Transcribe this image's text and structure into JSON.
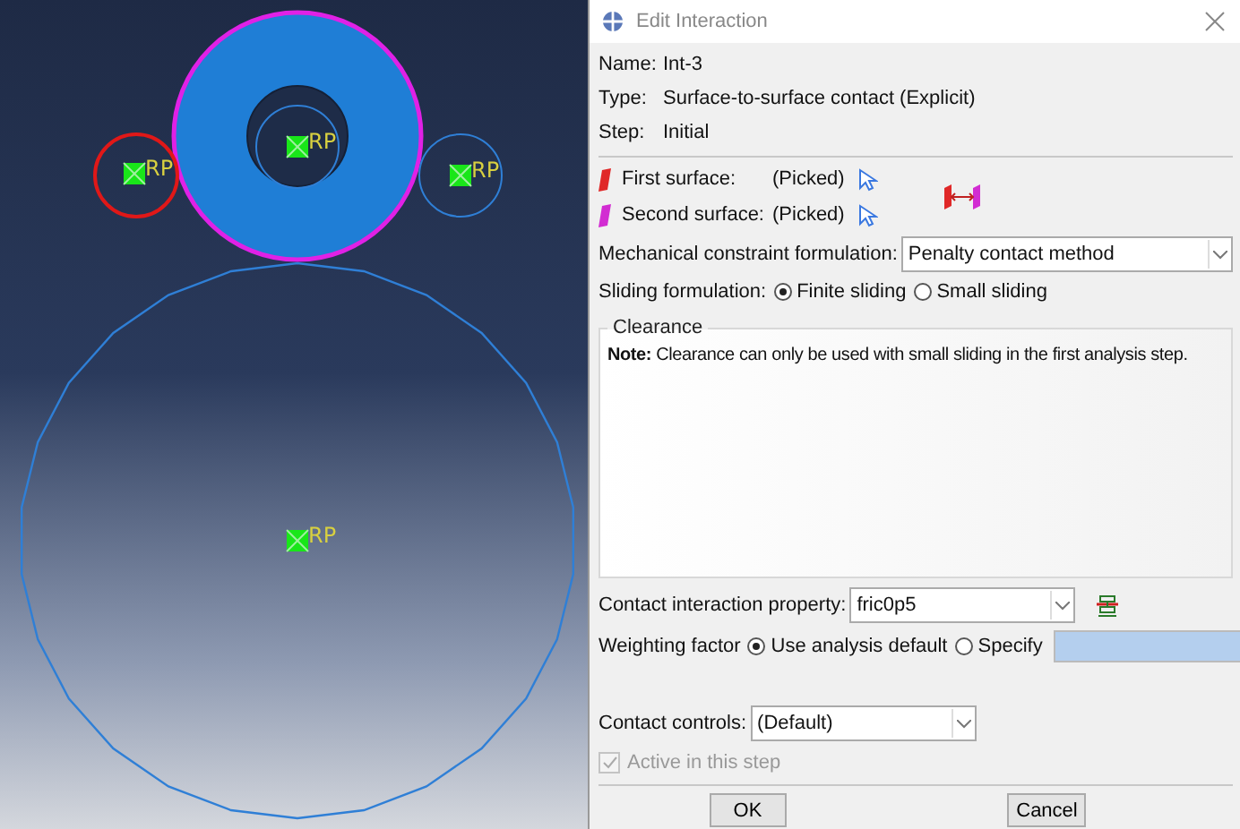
{
  "viewport": {
    "markers": [
      {
        "label": "RP"
      },
      {
        "label": "RP"
      },
      {
        "label": "RP"
      },
      {
        "label": "RP"
      }
    ]
  },
  "dialog": {
    "title": "Edit Interaction",
    "fields": [
      {
        "label": "Name:",
        "value": "Int-3"
      },
      {
        "label": "Type:",
        "value": "Surface-to-surface contact (Explicit)"
      },
      {
        "label": "Step:",
        "value": "Initial"
      }
    ],
    "surfaces": [
      {
        "label": "First surface:",
        "value": "(Picked)",
        "color": "#e02828"
      },
      {
        "label": "Second surface:",
        "value": "(Picked)",
        "color": "#d22cd2"
      }
    ],
    "mechanical": {
      "label": "Mechanical constraint formulation:",
      "value": "Penalty contact method"
    },
    "sliding": {
      "label": "Sliding formulation:",
      "options": [
        {
          "label": "Finite sliding",
          "selected": true
        },
        {
          "label": "Small sliding",
          "selected": false
        }
      ]
    },
    "clearance": {
      "title": "Clearance",
      "note": "**Note:**  Clearance can only be used with small sliding in the first analysis step."
    },
    "property": {
      "label": "Contact interaction property:",
      "value": "fric0p5"
    },
    "weighting": {
      "label": "Weighting factor",
      "options": [
        {
          "label": "Use analysis default",
          "selected": true
        },
        {
          "label": "Specify",
          "selected": false
        }
      ]
    },
    "controls": {
      "label": "Contact controls:",
      "value": "(Default)"
    },
    "active": {
      "label": "Active in this step",
      "checked": true,
      "disabled": true
    },
    "buttons": [
      "OK",
      "Cancel"
    ]
  }
}
